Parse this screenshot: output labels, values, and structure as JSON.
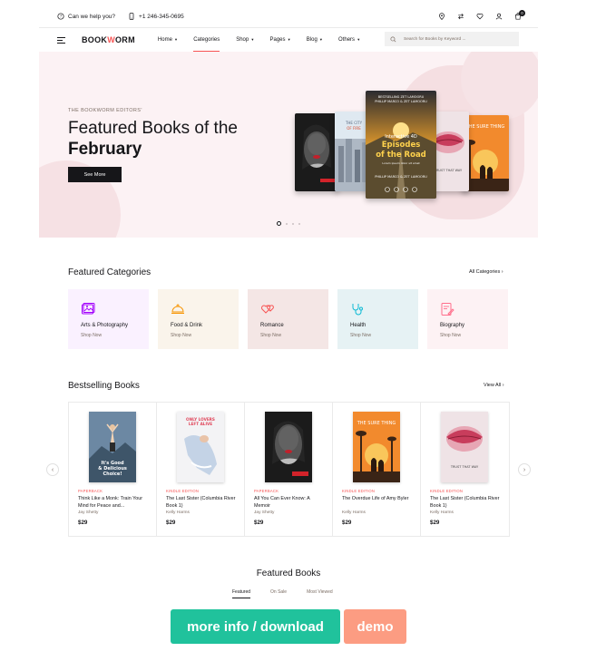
{
  "topbar": {
    "help": "Can we help you?",
    "phone": "+1 246-345-0695",
    "icons": [
      "map-pin-icon",
      "swap-icon",
      "heart-icon",
      "user-icon",
      "cart-icon"
    ],
    "cart_count": "0"
  },
  "nav": {
    "logo_prefix": "BOOK",
    "logo_mark": "W",
    "logo_suffix": "ORM",
    "items": [
      {
        "label": "Home",
        "caret": "▾"
      },
      {
        "label": "Categories",
        "caret": ""
      },
      {
        "label": "Shop",
        "caret": "▾"
      },
      {
        "label": "Pages",
        "caret": "▾"
      },
      {
        "label": "Blog",
        "caret": "▾"
      },
      {
        "label": "Others",
        "caret": "▾"
      }
    ],
    "active": "Categories",
    "search_placeholder": "Search for Books by Keyword ..."
  },
  "hero": {
    "eyebrow": "THE BOOKWORM EDITORS'",
    "title_line1": "Featured Books of the",
    "title_line2": "February",
    "button": "See More",
    "books": [
      {
        "title": "",
        "author": ""
      },
      {
        "title": "THE CITY OF FIRE",
        "author": ""
      },
      {
        "title": "Episodes of the Road",
        "kicker": "Interactive 4D",
        "author": "PHILLIP MARCO & ZET LAMOORU",
        "top": "BESTSELLING ZET LAMOORU"
      },
      {
        "title": "",
        "author": ""
      },
      {
        "title": "THE SURE THING",
        "author": ""
      }
    ]
  },
  "categories": {
    "title": "Featured Categories",
    "link": "All Categories",
    "items": [
      {
        "name": "Arts & Photography",
        "cta": "Shop Now",
        "bg": "#faf1ff",
        "color": "#a200fc"
      },
      {
        "name": "Food & Drink",
        "cta": "Shop Now",
        "bg": "#faf4eb",
        "color": "#f79400"
      },
      {
        "name": "Romance",
        "cta": "Shop Now",
        "bg": "#f4e6e5",
        "color": "#f75454"
      },
      {
        "name": "Health",
        "cta": "Shop Now",
        "bg": "#e6f2f4",
        "color": "#0cbad4"
      },
      {
        "name": "Biography",
        "cta": "Shop Now",
        "bg": "#fdf2f4",
        "color": "#ff6e8b"
      }
    ]
  },
  "bestselling": {
    "title": "Bestselling Books",
    "link": "View All",
    "books": [
      {
        "format": "PAPERBACK",
        "title": "Think Like a Monk: Train Your Mind for Peace and...",
        "author": "Jay Shetty",
        "price": "$29",
        "cover_text": "It's Good & Delicious Choice!"
      },
      {
        "format": "KINDLE EDITION",
        "title": "The Last Sister (Columbia River Book 1)",
        "author": "Kelly Harms",
        "price": "$29",
        "cover_text": "ONLY LOVERS LEFT ALIVE"
      },
      {
        "format": "PAPERBACK",
        "title": "All You Can Ever Know: A Memoir",
        "author": "Jay Shetty",
        "price": "$29",
        "cover_text": "RHYME"
      },
      {
        "format": "KINDLE EDITION",
        "title": "The Overdue Life of Amy Byler",
        "author": "Kelly Harms",
        "price": "$29",
        "cover_text": "THE SURE THING"
      },
      {
        "format": "KINDLE EDITION",
        "title": "The Last Sister (Columbia River Book 1)",
        "author": "Kelly Harms",
        "price": "$29",
        "cover_text": "TRUST THAT WAY"
      }
    ]
  },
  "featured": {
    "title": "Featured Books",
    "tabs": [
      "Featured",
      "On Sale",
      "Most Viewed"
    ],
    "active_tab": "Featured"
  },
  "cta": {
    "download": "more info / download",
    "demo": "demo"
  },
  "colors": {
    "accent": "#f75454",
    "dark": "#161619",
    "hero_bg": "#fcf2f4",
    "download_btn": "#20c29c",
    "demo_btn": "#fc9c82"
  }
}
